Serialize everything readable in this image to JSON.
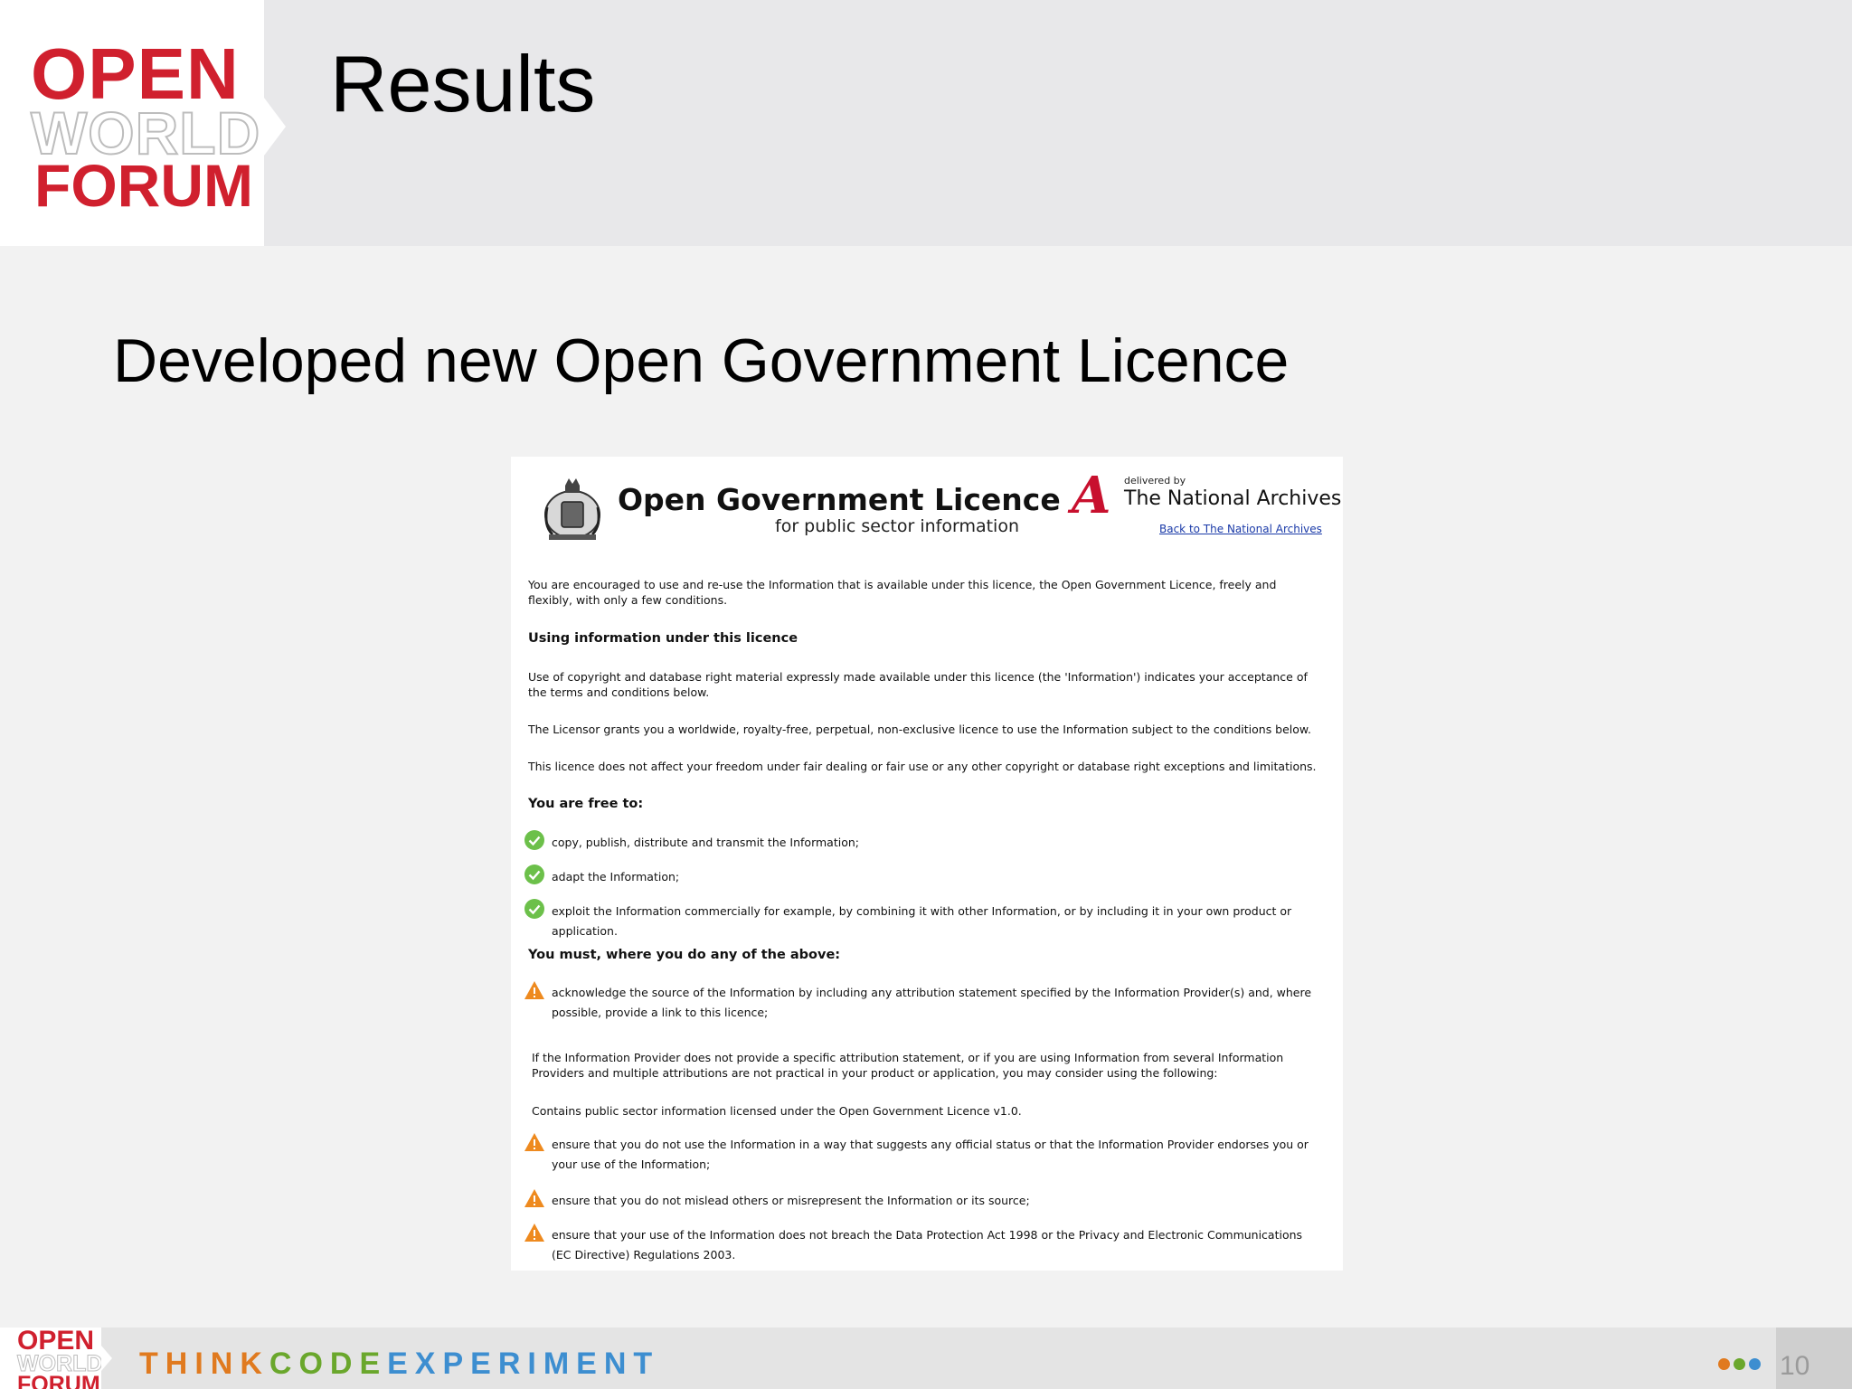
{
  "header": {
    "logo": [
      "OPEN",
      "WORLD",
      "FORUM"
    ],
    "title": "Results"
  },
  "subtitle": "Developed new Open Government Licence",
  "licence_doc": {
    "title": "Open Government Licence",
    "subtitle": "for public sector information",
    "tna_delivered_by": "delivered by",
    "tna_name": "The National Archives",
    "tna_back_link": "Back to The National Archives",
    "intro": "You are encouraged to use and re-use the Information that is available under this licence, the Open Government Licence, freely and flexibly, with only a few conditions.",
    "heading_using": "Using information under this licence",
    "para_copyright": "Use of copyright and database right material expressly made available under this licence (the 'Information') indicates your acceptance of the terms and conditions below.",
    "para_grant": "The Licensor grants you a worldwide, royalty-free, perpetual, non-exclusive licence to use the Information subject to the conditions below.",
    "para_fair": "This licence does not affect your freedom under fair dealing or fair use or any other copyright or database right exceptions and limitations.",
    "heading_free": "You are free to:",
    "free_items": [
      "copy, publish, distribute and transmit the Information;",
      "adapt the Information;",
      "exploit the Information commercially for example, by combining it with other Information, or by including it in your own product or application."
    ],
    "heading_must": "You must, where you do any of the above:",
    "must_item_1": "acknowledge the source of the Information by including any attribution statement specified by the Information Provider(s) and, where possible, provide a link to this licence;",
    "para_attribution": "If the Information Provider does not provide a specific attribution statement, or if you are using Information from several Information Providers and multiple attributions are not practical in your product or application, you may consider using the following:",
    "para_contains": "Contains public sector information licensed under the Open Government Licence v1.0.",
    "must_items_more": [
      "ensure that you do not use the Information in a way that suggests any official status or that the Information Provider endorses you or your use of the Information;",
      "ensure that you do not mislead others or misrepresent the Information or its source;",
      "ensure that your use of the Information does not breach the Data Protection Act 1998 or the Privacy and Electronic Communications (EC Directive) Regulations 2003."
    ]
  },
  "footer": {
    "logo": [
      "OPEN",
      "WORLD",
      "FORUM"
    ],
    "tagline_think": "THINK",
    "tagline_code": "CODE",
    "tagline_experiment": "EXPERIMENT",
    "page_number": "10",
    "dot_colors": [
      "#e07a1f",
      "#6aa72c",
      "#3d8ed0"
    ]
  },
  "icons": {
    "check": "check-circle-icon",
    "warning": "warning-triangle-icon"
  }
}
